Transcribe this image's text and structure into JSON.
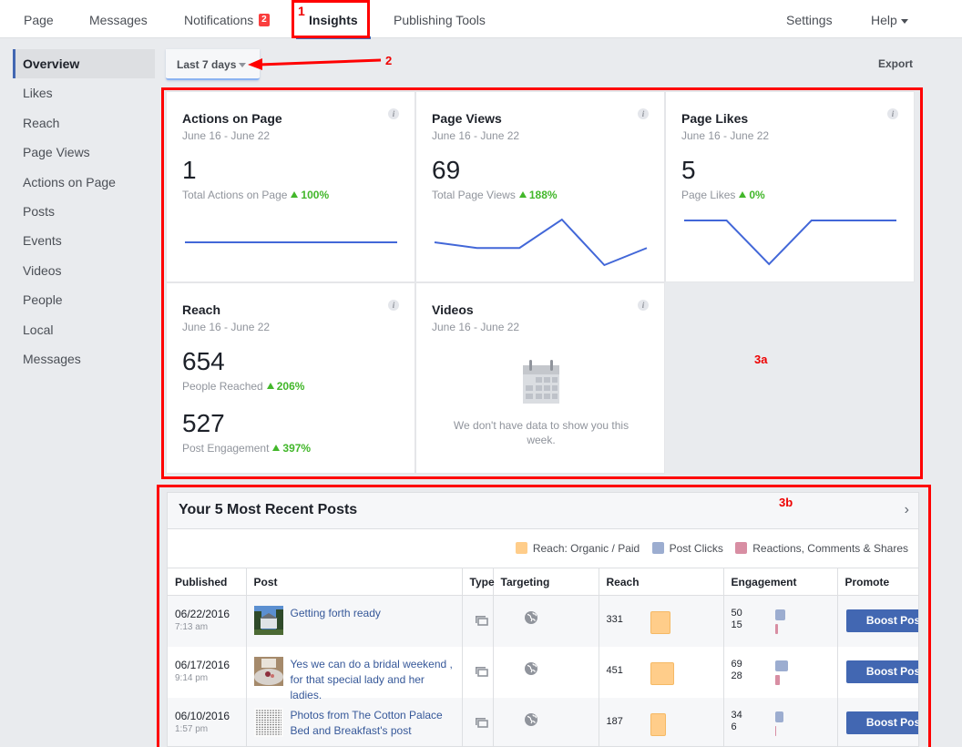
{
  "topnav": {
    "tabs": [
      {
        "label": "Page"
      },
      {
        "label": "Messages"
      },
      {
        "label": "Notifications",
        "badge": "2"
      },
      {
        "label": "Insights",
        "active": true
      },
      {
        "label": "Publishing Tools"
      }
    ],
    "right": {
      "settings": "Settings",
      "help": "Help"
    }
  },
  "sidebar": {
    "items": [
      {
        "label": "Overview",
        "active": true
      },
      {
        "label": "Likes"
      },
      {
        "label": "Reach"
      },
      {
        "label": "Page Views"
      },
      {
        "label": "Actions on Page"
      },
      {
        "label": "Posts"
      },
      {
        "label": "Events"
      },
      {
        "label": "Videos"
      },
      {
        "label": "People"
      },
      {
        "label": "Local"
      },
      {
        "label": "Messages"
      }
    ]
  },
  "toolbar": {
    "date_range": "Last 7 days",
    "export": "Export"
  },
  "annotations": {
    "a1": "1",
    "a2": "2",
    "a3a": "3a",
    "a3b": "3b"
  },
  "cards": {
    "actions": {
      "title": "Actions on Page",
      "date": "June 16 - June 22",
      "value": "1",
      "label": "Total Actions on Page",
      "change": "100%",
      "trend": [
        1,
        1,
        1,
        1,
        1,
        1,
        1
      ]
    },
    "views": {
      "title": "Page Views",
      "date": "June 16 - June 22",
      "value": "69",
      "label": "Total Page Views",
      "change": "188%",
      "trend": [
        9,
        8,
        8,
        13,
        5,
        8
      ]
    },
    "likes": {
      "title": "Page Likes",
      "date": "June 16 - June 22",
      "value": "5",
      "label": "Page Likes",
      "change": "0%",
      "trend": [
        1,
        1,
        0,
        1,
        1,
        1
      ]
    },
    "reach": {
      "title": "Reach",
      "date": "June 16 - June 22",
      "value": "654",
      "label": "People Reached",
      "change": "206%",
      "value2": "527",
      "label2": "Post Engagement",
      "change2": "397%"
    },
    "videos": {
      "title": "Videos",
      "date": "June 16 - June 22",
      "empty_message": "We don't have data to show you this week."
    }
  },
  "posts": {
    "title": "Your 5 Most Recent Posts",
    "legend": [
      {
        "label": "Reach: Organic / Paid",
        "color": "#ffcd8a"
      },
      {
        "label": "Post Clicks",
        "color": "#9cadd0"
      },
      {
        "label": "Reactions, Comments & Shares",
        "color": "#d88ea3"
      }
    ],
    "columns": [
      "Published",
      "Post",
      "Type",
      "Targeting",
      "Reach",
      "Engagement",
      "Promote"
    ],
    "rows": [
      {
        "date": "06/22/2016",
        "time": "7:13 am",
        "text": "Getting forth ready",
        "thumb": "house",
        "reach": 331,
        "clicks": 50,
        "reactions": 15,
        "promote": "Boost Post"
      },
      {
        "date": "06/17/2016",
        "time": "9:14 pm",
        "text": "Yes we can do a bridal weekend , for that special lady and her ladies.",
        "thumb": "table",
        "reach": 451,
        "clicks": 69,
        "reactions": 28,
        "promote": "Boost Post"
      },
      {
        "date": "06/10/2016",
        "time": "1:57 pm",
        "text": "Photos from The Cotton Palace Bed and Breakfast's post",
        "thumb": "document",
        "reach": 187,
        "clicks": 34,
        "reactions": 6,
        "promote": "Boost Post"
      }
    ]
  },
  "colors": {
    "accent": "#4267b2",
    "positive": "#42b72a",
    "link": "#365899",
    "annotation": "#ff0000"
  }
}
